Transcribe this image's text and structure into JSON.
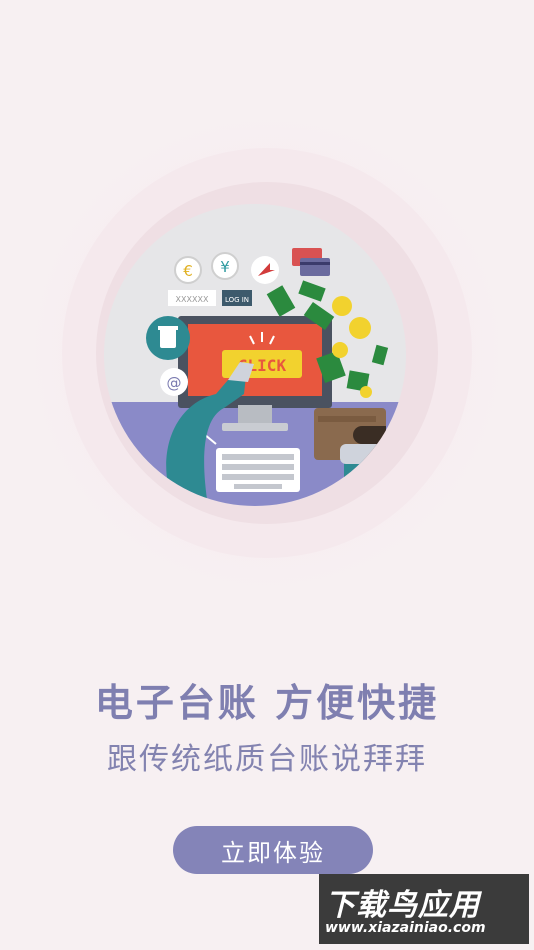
{
  "hero": {
    "click_label": "CLICK",
    "login_label": "LOG IN",
    "input_mask": "XXXXXX"
  },
  "headline": "电子台账  方便快捷",
  "subline": "跟传统纸质台账说拜拜",
  "cta_label": "立即体验",
  "watermark": {
    "title": "下载鸟应用",
    "url": "www.xiazainiao.com"
  },
  "colors": {
    "background": "#f7f0f2",
    "accent": "#8484b8",
    "text": "#7f7fb0"
  },
  "icons": [
    "euro-coin-icon",
    "yen-coin-icon",
    "cursor-arrow-icon",
    "credit-card-icon",
    "cup-icon",
    "at-sign-icon",
    "wallet-icon",
    "money-note-icon"
  ]
}
